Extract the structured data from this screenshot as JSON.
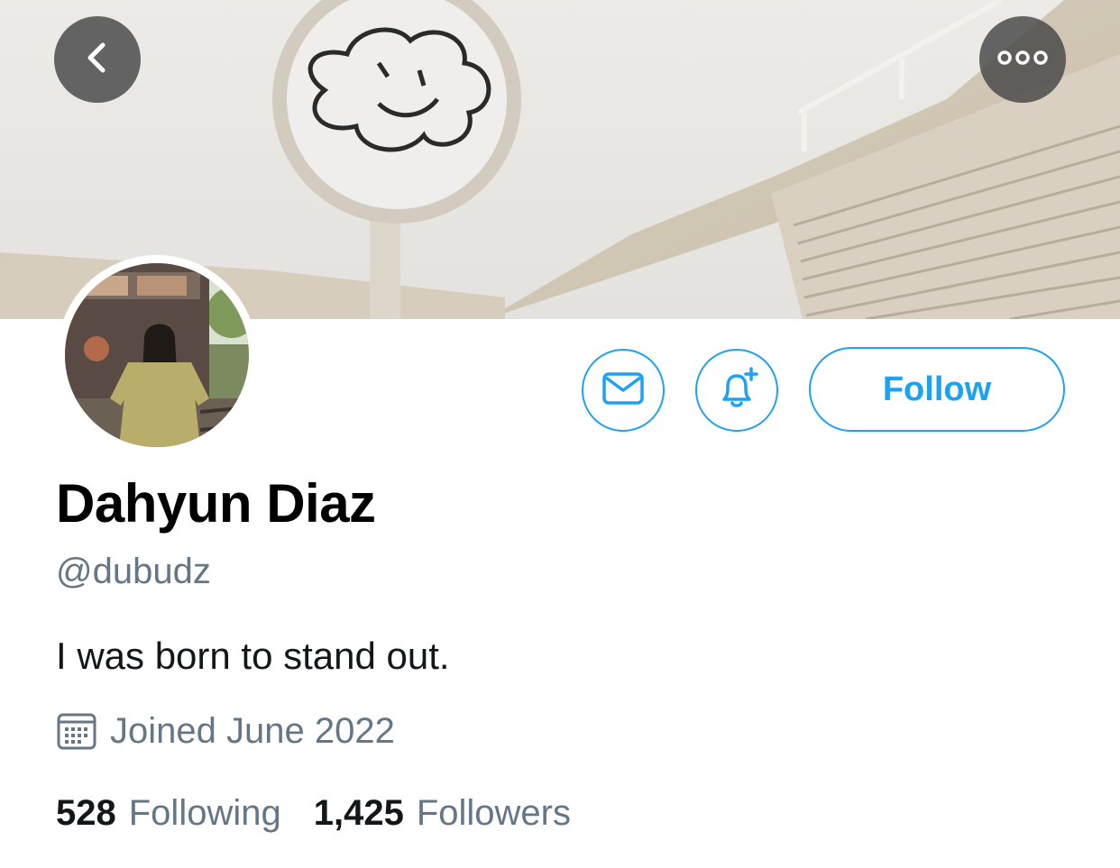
{
  "profile": {
    "display_name": "Dahyun Diaz",
    "handle": "@dubudz",
    "bio": "I was born to stand out.",
    "joined": "Joined June 2022"
  },
  "stats": {
    "following_count": "528",
    "following_label": "Following",
    "followers_count": "1,425",
    "followers_label": "Followers"
  },
  "actions": {
    "follow_label": "Follow"
  },
  "icons": {
    "back": "chevron-left-icon",
    "more": "more-horizontal-icon",
    "message": "envelope-icon",
    "notify": "bell-plus-icon",
    "joined": "calendar-icon"
  },
  "colors": {
    "accent": "#1da1f2",
    "secondary_text": "#657786",
    "primary_text": "#14171a"
  }
}
